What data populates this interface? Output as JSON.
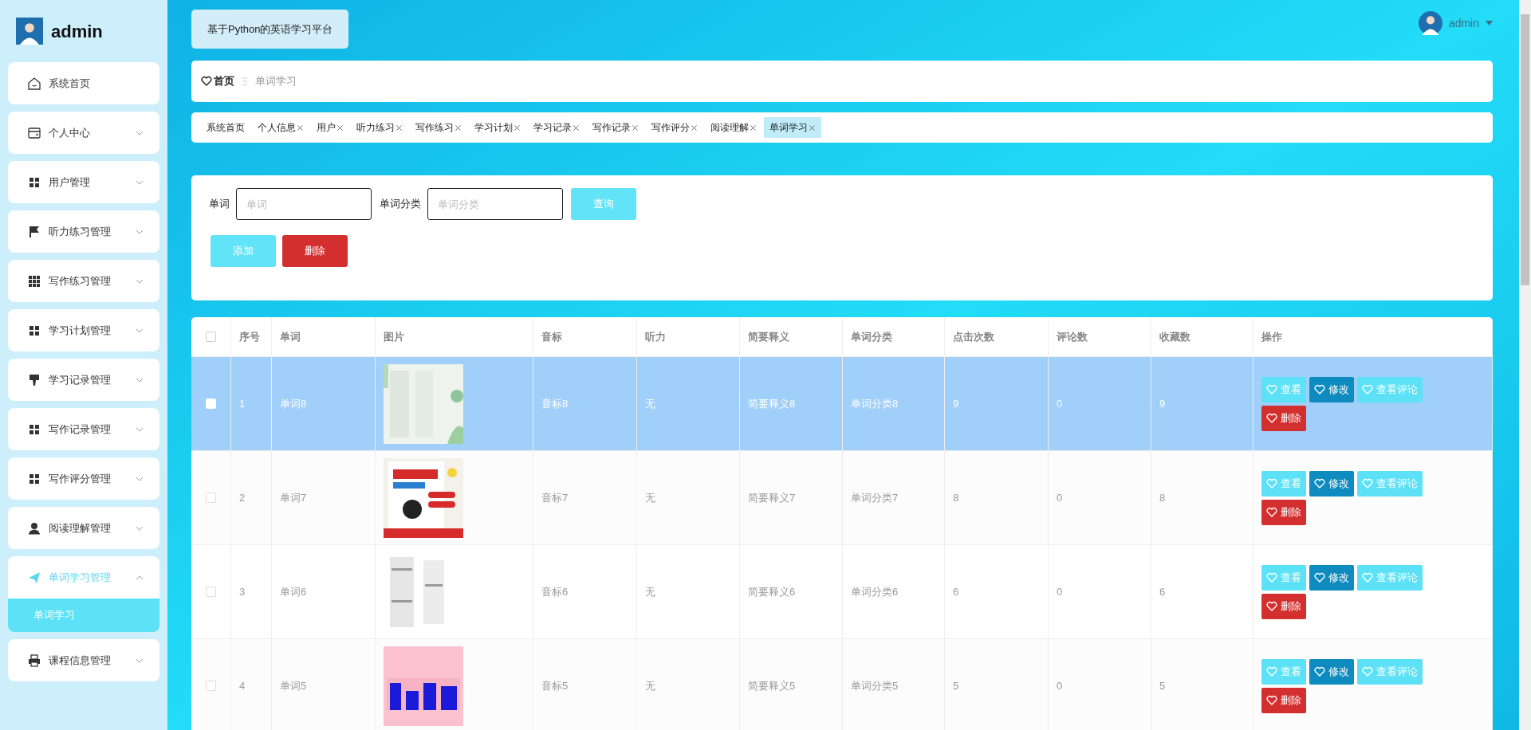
{
  "sidebar": {
    "user": "admin",
    "items": [
      {
        "label": "系统首页"
      },
      {
        "label": "个人中心",
        "expanded": false
      },
      {
        "label": "用户管理",
        "expanded": false
      },
      {
        "label": "听力练习管理",
        "expanded": false
      },
      {
        "label": "写作练习管理",
        "expanded": false
      },
      {
        "label": "学习计划管理",
        "expanded": false
      },
      {
        "label": "学习记录管理",
        "expanded": false
      },
      {
        "label": "写作记录管理",
        "expanded": false
      },
      {
        "label": "写作评分管理",
        "expanded": false
      },
      {
        "label": "阅读理解管理",
        "expanded": false
      },
      {
        "label": "单词学习管理",
        "expanded": true,
        "children": [
          {
            "label": "单词学习",
            "selected": true
          }
        ]
      },
      {
        "label": "课程信息管理",
        "expanded": false
      }
    ]
  },
  "header": {
    "title": "基于Python的英语学习平台",
    "user": "admin"
  },
  "breadcrumb": {
    "home": "首页",
    "current": "单词学习"
  },
  "tags": [
    {
      "label": "系统首页",
      "closable": false,
      "selected": false
    },
    {
      "label": "个人信息",
      "closable": true,
      "selected": false
    },
    {
      "label": "用户",
      "closable": true,
      "selected": false
    },
    {
      "label": "听力练习",
      "closable": true,
      "selected": false
    },
    {
      "label": "写作练习",
      "closable": true,
      "selected": false
    },
    {
      "label": "学习计划",
      "closable": true,
      "selected": false
    },
    {
      "label": "学习记录",
      "closable": true,
      "selected": false
    },
    {
      "label": "写作记录",
      "closable": true,
      "selected": false
    },
    {
      "label": "写作评分",
      "closable": true,
      "selected": false
    },
    {
      "label": "阅读理解",
      "closable": true,
      "selected": false
    },
    {
      "label": "单词学习",
      "closable": true,
      "selected": true
    }
  ],
  "search": {
    "fields": [
      {
        "label": "单词",
        "placeholder": "单词"
      },
      {
        "label": "单词分类",
        "placeholder": "单词分类"
      }
    ],
    "query_button": "查询",
    "add_button": "添加",
    "delete_button": "删除"
  },
  "table": {
    "all_checked": false,
    "columns": [
      "序号",
      "单词",
      "图片",
      "音标",
      "听力",
      "简要释义",
      "单词分类",
      "点击次数",
      "评论数",
      "收藏数",
      "操作"
    ],
    "rows": [
      {
        "selected": true,
        "cells": [
          "1",
          "单词8",
          {
            "kind": "picture"
          },
          "音标8",
          "无",
          "简要释义8",
          "单词分类8",
          "9",
          "0",
          "9",
          {
            "kind": "actions",
            "buttons": [
              {
                "kind": "view",
                "label": "查看"
              },
              {
                "kind": "edit",
                "label": "修改"
              },
              {
                "kind": "comments",
                "label": "查看评论"
              },
              {
                "kind": "delete",
                "label": "删除"
              }
            ]
          }
        ]
      },
      {
        "selected": false,
        "cells": [
          "2",
          "单词7",
          {
            "kind": "picture"
          },
          "音标7",
          "无",
          "简要释义7",
          "单词分类7",
          "8",
          "0",
          "8",
          {
            "kind": "actions",
            "buttons": [
              {
                "kind": "view",
                "label": "查看"
              },
              {
                "kind": "edit",
                "label": "修改"
              },
              {
                "kind": "comments",
                "label": "查看评论"
              },
              {
                "kind": "delete",
                "label": "删除"
              }
            ]
          }
        ]
      },
      {
        "selected": false,
        "cells": [
          "3",
          "单词6",
          {
            "kind": "picture"
          },
          "音标6",
          "无",
          "简要释义6",
          "单词分类6",
          "6",
          "0",
          "6",
          {
            "kind": "actions",
            "buttons": [
              {
                "kind": "view",
                "label": "查看"
              },
              {
                "kind": "edit",
                "label": "修改"
              },
              {
                "kind": "comments",
                "label": "查看评论"
              },
              {
                "kind": "delete",
                "label": "删除"
              }
            ]
          }
        ]
      },
      {
        "selected": false,
        "cells": [
          "4",
          "单词5",
          {
            "kind": "picture"
          },
          "音标5",
          "无",
          "简要释义5",
          "单词分类5",
          "5",
          "0",
          "5",
          {
            "kind": "actions",
            "buttons": [
              {
                "kind": "view",
                "label": "查看"
              },
              {
                "kind": "edit",
                "label": "修改"
              },
              {
                "kind": "comments",
                "label": "查看评论"
              },
              {
                "kind": "delete",
                "label": "删除"
              }
            ]
          }
        ]
      }
    ]
  }
}
